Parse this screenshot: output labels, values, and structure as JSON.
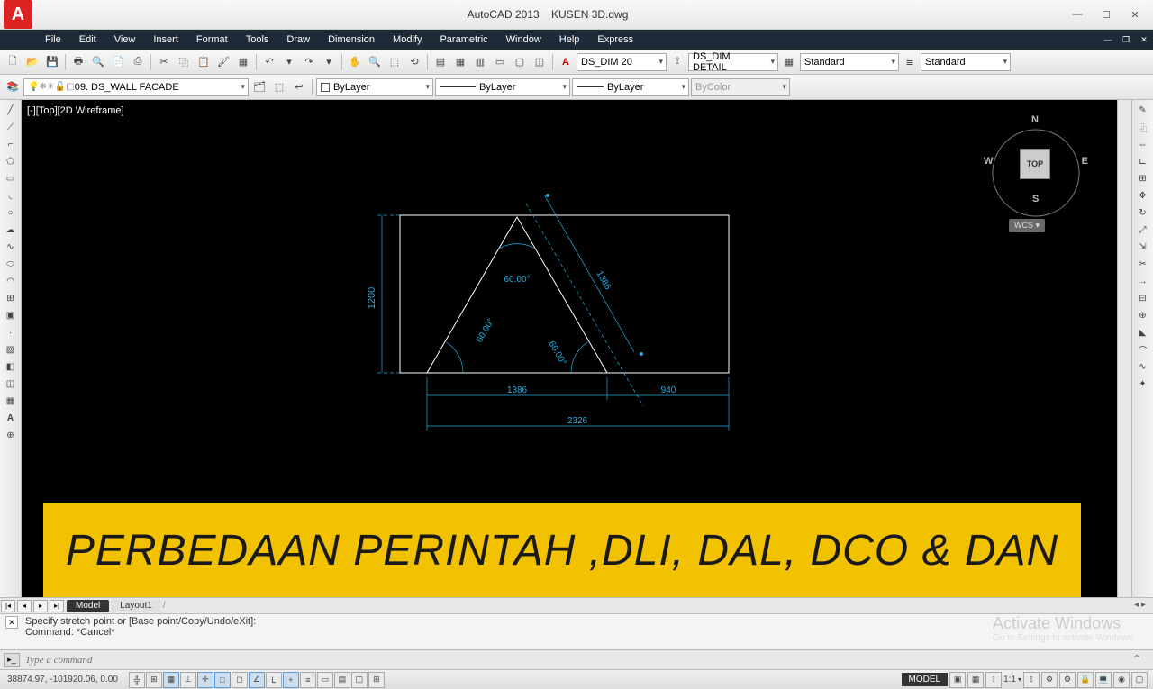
{
  "title": {
    "app": "AutoCAD 2013",
    "file": "KUSEN 3D.dwg"
  },
  "menu": [
    "File",
    "Edit",
    "View",
    "Insert",
    "Format",
    "Tools",
    "Draw",
    "Dimension",
    "Modify",
    "Parametric",
    "Window",
    "Help",
    "Express"
  ],
  "toolbar1": {
    "textStyle": "DS_DIM 20",
    "dimStyle": "DS_DIM DETAIL",
    "tableStyle": "Standard",
    "mlStyle": "Standard"
  },
  "toolbar2": {
    "layer": "09. DS_WALL FACADE",
    "linetype1": "ByLayer",
    "linetype2": "ByLayer",
    "linetype3": "ByLayer",
    "color": "ByColor"
  },
  "viewport": {
    "label": "[-][Top][2D Wireframe]"
  },
  "viewcube": {
    "face": "TOP",
    "n": "N",
    "s": "S",
    "e": "E",
    "w": "W",
    "wcs": "WCS"
  },
  "drawing": {
    "dim_height": "1200",
    "dim_angle_top": "60.00°",
    "dim_angle_left": "60.00°",
    "dim_angle_right": "60.00°",
    "dim_aligned": "1386",
    "dim_base1": "1386",
    "dim_base2": "940",
    "dim_total": "2326"
  },
  "banner": "PERBEDAAN PERINTAH ,DLI, DAL, DCO & DAN",
  "tabs": {
    "active": "Model",
    "others": [
      "Layout1"
    ]
  },
  "command": {
    "line1": "Specify stretch point or [Base point/Copy/Undo/eXit]:",
    "line2": "Command: *Cancel*",
    "placeholder": "Type a command"
  },
  "watermark": {
    "title": "Activate Windows",
    "sub": "Go to Settings to activate Windows."
  },
  "status": {
    "coords": "38874.97, -101920.06, 0.00",
    "model": "MODEL",
    "scale": "1:1"
  }
}
